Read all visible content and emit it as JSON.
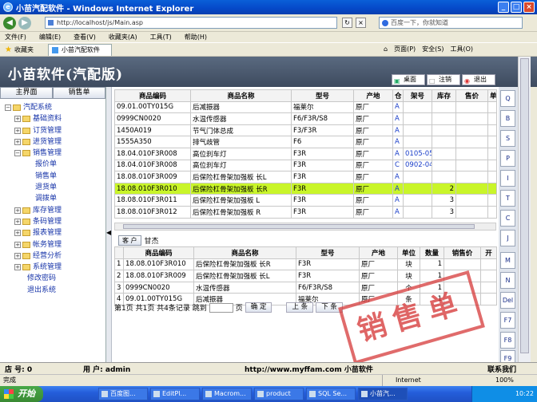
{
  "window": {
    "title": "小苗汽配软件 - Windows Internet Explorer"
  },
  "browser": {
    "address": "http://localhost/js/Main.asp",
    "search_placeholder": "百度一下，你就知道",
    "menus": [
      "文件(F)",
      "编辑(E)",
      "查看(V)",
      "收藏夹(A)",
      "工具(T)",
      "帮助(H)"
    ],
    "favorites": "收藏夹",
    "tab_label": "小苗汽配软件",
    "tools": [
      "页面(P)",
      "安全(S)",
      "工具(O)"
    ]
  },
  "app": {
    "brand": "小苗软件(汽配版)",
    "top_buttons": [
      "桌面",
      "注销",
      "退出"
    ]
  },
  "sidebar": {
    "tabs": [
      "主界面",
      "销售单"
    ],
    "root": "汽配系统",
    "items": [
      {
        "label": "基础资料",
        "level": 1
      },
      {
        "label": "订货管理",
        "level": 1
      },
      {
        "label": "进货管理",
        "level": 1
      },
      {
        "label": "销售管理",
        "level": 1,
        "expanded": true
      },
      {
        "label": "报价单",
        "level": 2
      },
      {
        "label": "销售单",
        "level": 2
      },
      {
        "label": "退货单",
        "level": 2
      },
      {
        "label": "调拨单",
        "level": 2
      },
      {
        "label": "库存管理",
        "level": 1
      },
      {
        "label": "条码管理",
        "level": 1
      },
      {
        "label": "报表管理",
        "level": 1
      },
      {
        "label": "帐务管理",
        "level": 1
      },
      {
        "label": "经营分析",
        "level": 1
      },
      {
        "label": "系统管理",
        "level": 1
      },
      {
        "label": "修改密码",
        "level": 0
      },
      {
        "label": "退出系统",
        "level": 0
      }
    ]
  },
  "products": {
    "columns": [
      "商品编码",
      "商品名称",
      "型号",
      "产地",
      "仓",
      "架号",
      "库存",
      "售价",
      "单"
    ],
    "rows": [
      [
        "09.01.00TY015G",
        "后减振器",
        "福莱尔",
        "原厂",
        "A",
        "",
        "",
        "",
        ""
      ],
      [
        "0999CN0020",
        "水温传感器",
        "F6/F3R/S8",
        "原厂",
        "A",
        "",
        "",
        "",
        ""
      ],
      [
        "1450A019",
        "节气门体总成",
        "F3/F3R",
        "原厂",
        "A",
        "",
        "",
        "",
        ""
      ],
      [
        "1555A350",
        "排气歧管",
        "F6",
        "原厂",
        "A",
        "",
        "",
        "",
        ""
      ],
      [
        "18.04.010F3R008",
        "高位刹车灯",
        "F3R",
        "原厂",
        "A",
        "0105-05",
        "",
        "",
        ""
      ],
      [
        "18.04.010F3R008",
        "高位刹车灯",
        "F3R",
        "原厂",
        "C",
        "0902-04",
        "",
        "",
        ""
      ],
      [
        "18.08.010F3R009",
        "后保险杠骨架加强板 长L",
        "F3R",
        "原厂",
        "A",
        "",
        "",
        "",
        ""
      ],
      [
        "18.08.010F3R010",
        "后保险杠骨架加强板 长R",
        "F3R",
        "原厂",
        "A",
        "",
        "2",
        "",
        ""
      ],
      [
        "18.08.010F3R011",
        "后保险杠骨架加强板 L",
        "F3R",
        "原厂",
        "A",
        "",
        "3",
        "",
        ""
      ],
      [
        "18.08.010F3R012",
        "后保险杠骨架加强板 R",
        "F3R",
        "原厂",
        "A",
        "",
        "3",
        "",
        ""
      ]
    ],
    "highlighted_row": 7
  },
  "customer": {
    "button": "客 户",
    "name": "甘杰"
  },
  "order": {
    "columns": [
      "",
      "商品编码",
      "商品名称",
      "型号",
      "产地",
      "单位",
      "数量",
      "销售价",
      "开"
    ],
    "rows": [
      [
        "1",
        "18.08.010F3R010",
        "后保险杠骨架加强板 长R",
        "F3R",
        "原厂",
        "块",
        "1",
        "",
        ""
      ],
      [
        "2",
        "18.08.010F3R009",
        "后保险杠骨架加强板 长L",
        "F3R",
        "原厂",
        "块",
        "1",
        "",
        ""
      ],
      [
        "3",
        "0999CN0020",
        "水温传感器",
        "F6/F3R/S8",
        "原厂",
        "个",
        "1",
        "",
        ""
      ],
      [
        "4",
        "09.01.00TY015G",
        "后减振器",
        "福莱尔",
        "原厂",
        "条",
        "1",
        "",
        ""
      ]
    ]
  },
  "pager": {
    "text": "第1页 共1页 共4条记录 跳到",
    "page_unit": "页",
    "confirm": "确 定",
    "prev": "上 条",
    "next": "下 条"
  },
  "stamp": {
    "text": "销售单"
  },
  "keys": [
    "Q",
    "B",
    "S",
    "P",
    "I",
    "T",
    "C",
    "J",
    "M",
    "N",
    "Del",
    "F7",
    "F8",
    "F9"
  ],
  "app_status": {
    "shop": "店 号: 0",
    "user": "用 户: admin",
    "site": "http://www.myffam.com 小苗软件",
    "contact": "联系我们"
  },
  "ie_status": {
    "left": "完成",
    "zone": "Internet",
    "zoom": "100%"
  },
  "taskbar": {
    "start": "开始",
    "items": [
      "百度图...",
      "EditPl...",
      "Macrom...",
      "product",
      "SQL Se...",
      "小苗汽..."
    ],
    "clock": "10:22"
  }
}
